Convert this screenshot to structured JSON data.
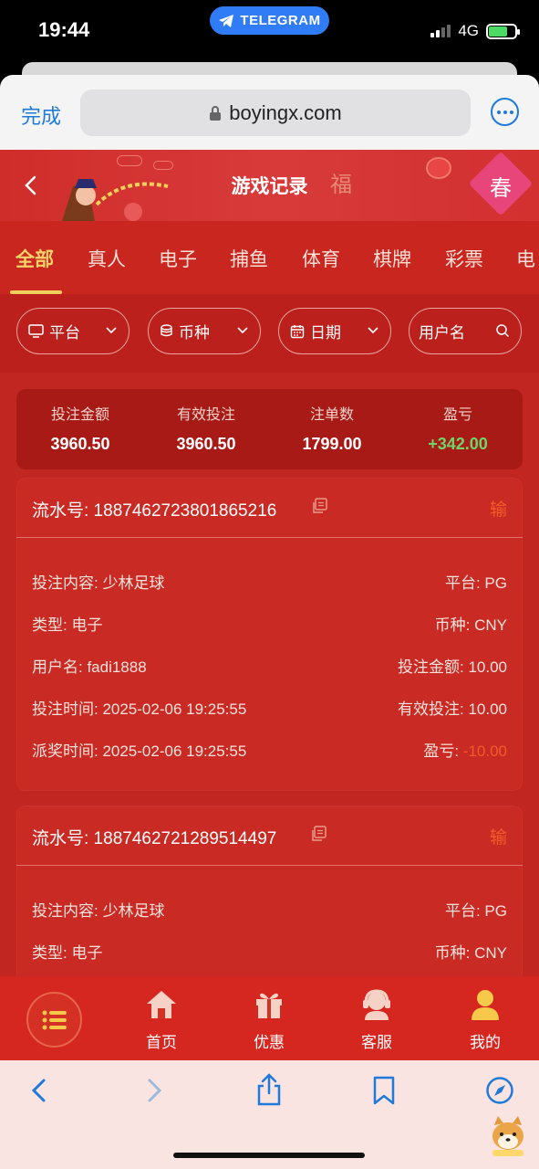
{
  "status_bar": {
    "time": "19:44",
    "pill": "TELEGRAM",
    "network": "4G"
  },
  "browser": {
    "done": "完成",
    "url": "boyingx.com"
  },
  "header": {
    "title": "游戏记录",
    "decor_fu": "福",
    "decor_chun": "春"
  },
  "tabs": [
    "全部",
    "真人",
    "电子",
    "捕鱼",
    "体育",
    "棋牌",
    "彩票",
    "电"
  ],
  "active_tab": "全部",
  "filters": {
    "platform": "平台",
    "currency": "币种",
    "date": "日期",
    "username_placeholder": "用户名"
  },
  "summary": {
    "bet_amount_label": "投注金额",
    "bet_amount": "3960.50",
    "valid_bet_label": "有效投注",
    "valid_bet": "3960.50",
    "order_count_label": "注单数",
    "order_count": "1799.00",
    "profit_label": "盈亏",
    "profit": "+342.00"
  },
  "records": [
    {
      "serial": "流水号: 1887462723801865216",
      "result": "输",
      "content": "投注内容: 少林足球",
      "platform": "平台: PG",
      "type": "类型: 电子",
      "currency": "币种: CNY",
      "username": "用户名: fadi1888",
      "bet_amount": "投注金额: 10.00",
      "bet_time": "投注时间: 2025-02-06 19:25:55",
      "valid_bet": "有效投注: 10.00",
      "payout_time": "派奖时间: 2025-02-06 19:25:55",
      "profit_label": "盈亏: ",
      "profit_value": "-10.00"
    },
    {
      "serial": "流水号: 1887462721289514497",
      "result": "输",
      "content": "投注内容: 少林足球",
      "platform": "平台: PG",
      "type": "类型: 电子",
      "currency": "币种: CNY"
    }
  ],
  "bottom_nav": {
    "home": "首页",
    "promo": "优惠",
    "service": "客服",
    "mine": "我的"
  },
  "colors": {
    "primary_red": "#c22620",
    "gold": "#f2cf58",
    "loss": "#f15a28",
    "gain": "#6dd66a",
    "browser_blue": "#1f7ad9"
  }
}
